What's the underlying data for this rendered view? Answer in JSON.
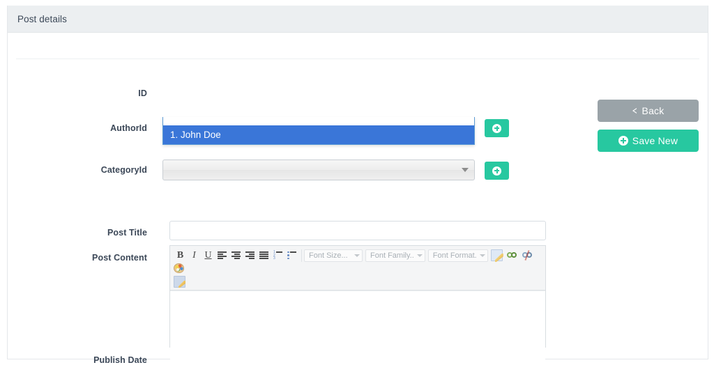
{
  "panel": {
    "title": "Post details"
  },
  "form": {
    "fields": [
      {
        "label": "ID",
        "value": ""
      },
      {
        "label": "AuthorId",
        "value": ""
      },
      {
        "label": "CategoryId",
        "value": ""
      },
      {
        "label": "Post Title",
        "value": "",
        "placeholder": ""
      },
      {
        "label": "Post Content",
        "value": ""
      },
      {
        "label": "Publish Date",
        "value": ""
      }
    ]
  },
  "author_select": {
    "selected_text": "",
    "expanded": true,
    "options": [
      {
        "label": "1. John Doe",
        "selected": true
      }
    ]
  },
  "category_select": {
    "selected_text": ""
  },
  "add_buttons": {
    "author_add_title": "",
    "category_add_title": ""
  },
  "editor": {
    "toolbar": {
      "bold": "B",
      "italic": "I",
      "underline": "U",
      "align_left": "align-left",
      "align_center": "align-center",
      "align_right": "align-right",
      "align_justify": "align-justify",
      "ordered_list": "ordered-list",
      "unordered_list": "unordered-list",
      "font_size": "Font Size...",
      "font_family": "Font Family..",
      "font_format": "Font Format.",
      "edit_source": "source-edit",
      "insert_link": "link",
      "remove_link": "unlink",
      "text_color": "palette",
      "source_row2": "source-edit"
    },
    "content": ""
  },
  "actions": {
    "back_label": "Back",
    "save_label": "Save New"
  },
  "colors": {
    "header_bg": "#eceff1",
    "accent_green": "#27c8a0",
    "back_gray": "#9aa3a8",
    "option_highlight": "#3a76d8",
    "label_text": "#3c4858"
  }
}
